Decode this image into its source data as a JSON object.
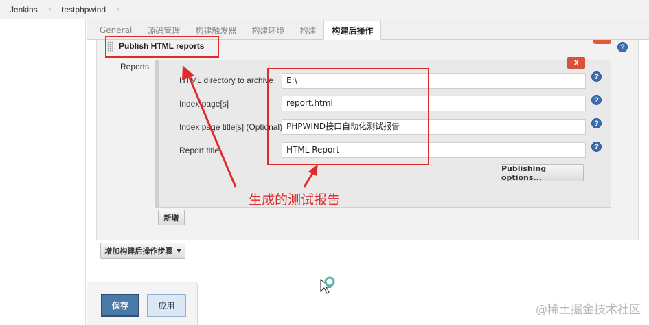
{
  "breadcrumb": [
    "Jenkins",
    "testphpwind"
  ],
  "tabs": [
    "General",
    "源码管理",
    "构建触发器",
    "构建环境",
    "构建",
    "构建后操作"
  ],
  "active_tab": "构建后操作",
  "section": {
    "title": "Publish HTML reports",
    "reports_label": "Reports",
    "delete_label": "X",
    "fields": [
      {
        "label": "HTML directory to archive",
        "value": "E:\\"
      },
      {
        "label": "Index page[s]",
        "value": "report.html"
      },
      {
        "label": "Index page title[s] (Optional)",
        "value": "PHPWIND接口自动化测试报告"
      },
      {
        "label": "Report title",
        "value": "HTML Report"
      }
    ],
    "publishing_options_label": "Publishing options...",
    "add_label": "新增"
  },
  "add_step_label": "增加构建后操作步骤",
  "help_glyph": "?",
  "annotation_text": "生成的测试报告",
  "footer": {
    "save_label": "保存",
    "apply_label": "应用"
  },
  "watermark": "@稀土掘金技术社区",
  "colors": {
    "accent": "#e02b2b",
    "help": "#3d6fb0",
    "save": "#4a7aa8",
    "delete": "#d9533a"
  }
}
